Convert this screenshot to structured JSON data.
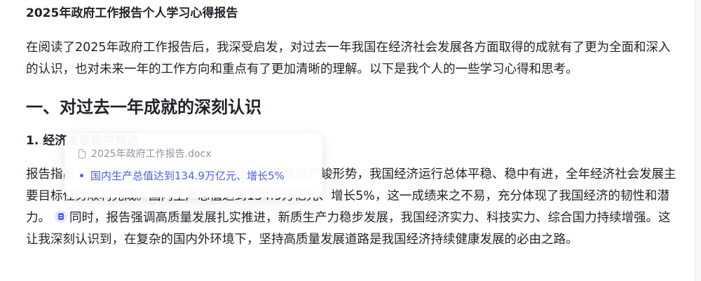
{
  "document": {
    "title": "2025年政府工作报告个人学习心得报告",
    "intro": "在阅读了2025年政府工作报告后，我深受启发，对过去一年我国在经济社会发展各方面取得的成就有了更为全面和深入的认识，也对未来一年的工作方向和重点有了更加清晰的理解。以下是我个人的一些学习心得和思考。",
    "section1_heading": "一、对过去一年成就的深刻认识",
    "subsection1_heading": "1. 经济发展稳中有进",
    "body_before_citation": "报告指出，面对外部压力加大、内部困难增多的复杂严峻形势，我国经济运行总体平稳、稳中有进，全年经济社会发展主要目标任务顺利完成。国内生产总值达到134.9万亿元、增长5%，这一成绩来之不易，充分体现了我国经济的韧性和潜力。",
    "body_after_citation": "同时，报告强调高质量发展扎实推进，新质生产力稳步发展，我国经济实力、科技实力、综合国力持续增强。这让我深刻认识到，在复杂的国内外环境下，坚持高质量发展道路是我国经济持续健康发展的必由之路。"
  },
  "citation_popover": {
    "source_file": "2025年政府工作报告.docx",
    "reference_text": "国内生产总值达到134.9万亿元、增长5%"
  },
  "colors": {
    "text": "#1f2329",
    "link_accent": "#4e61e6",
    "muted": "#8f959e",
    "citation_chip_bg": "#e7e9fb"
  }
}
